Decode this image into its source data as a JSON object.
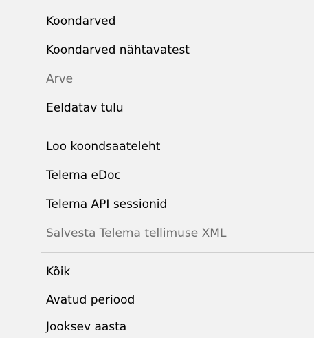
{
  "menu": {
    "groups": [
      {
        "items": [
          {
            "label": "Koondarved",
            "enabled": true
          },
          {
            "label": "Koondarved nähtavatest",
            "enabled": true
          },
          {
            "label": "Arve",
            "enabled": false
          },
          {
            "label": "Eeldatav tulu",
            "enabled": true
          }
        ]
      },
      {
        "items": [
          {
            "label": "Loo koondsaateleht",
            "enabled": true
          },
          {
            "label": "Telema eDoc",
            "enabled": true
          },
          {
            "label": "Telema API sessionid",
            "enabled": true
          },
          {
            "label": "Salvesta Telema tellimuse XML",
            "enabled": false
          }
        ]
      },
      {
        "items": [
          {
            "label": "Kõik",
            "enabled": true
          },
          {
            "label": "Avatud periood",
            "enabled": true
          },
          {
            "label": "Jooksev aasta",
            "enabled": true
          }
        ]
      }
    ]
  },
  "colors": {
    "background": "#f2f2f2",
    "text": "#000000",
    "disabled_text": "#6d6d6d",
    "separator": "#cfcfcf"
  }
}
